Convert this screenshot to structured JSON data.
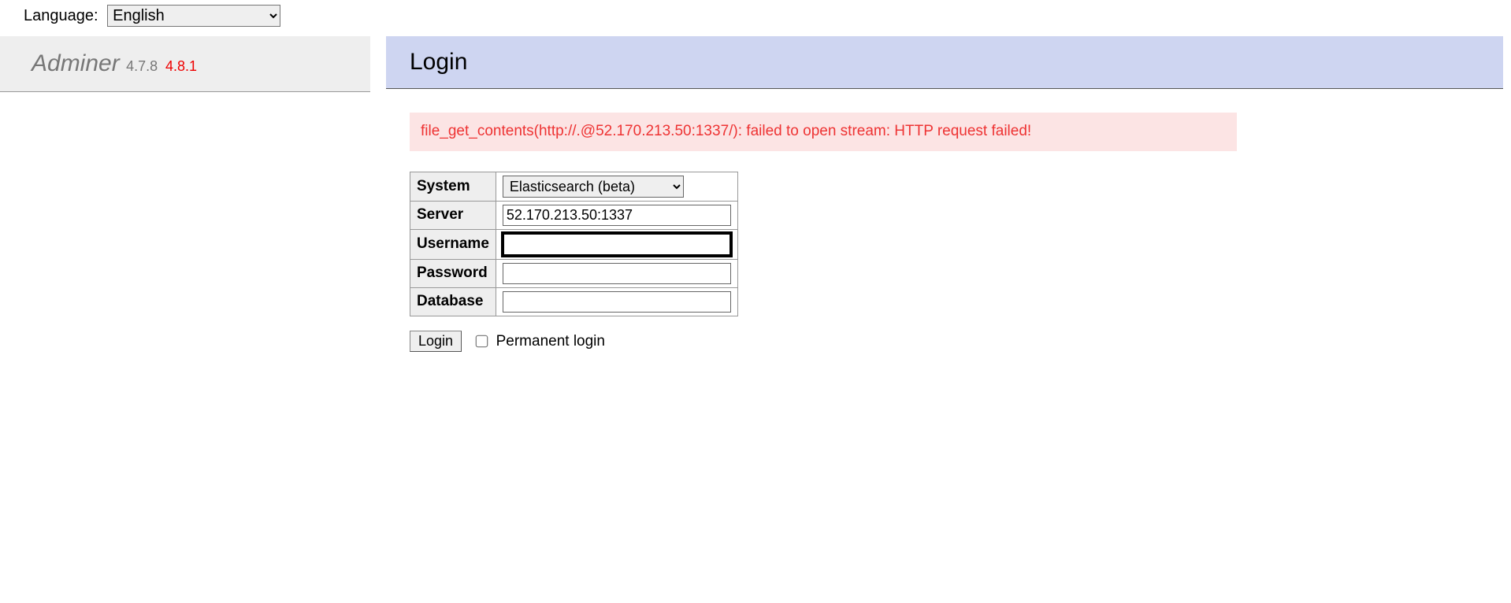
{
  "language": {
    "label": "Language:",
    "selected": "English"
  },
  "brand": {
    "name": "Adminer",
    "version_current": "4.7.8",
    "version_latest": "4.8.1"
  },
  "page": {
    "title": "Login"
  },
  "error": {
    "message": "file_get_contents(http://.@52.170.213.50:1337/): failed to open stream: HTTP request failed!"
  },
  "form": {
    "system": {
      "label": "System",
      "selected": "Elasticsearch (beta)"
    },
    "server": {
      "label": "Server",
      "value": "52.170.213.50:1337"
    },
    "username": {
      "label": "Username",
      "value": ""
    },
    "password": {
      "label": "Password",
      "value": ""
    },
    "database": {
      "label": "Database",
      "value": ""
    },
    "submit_label": "Login",
    "permanent_label": "Permanent login",
    "permanent_checked": false
  }
}
